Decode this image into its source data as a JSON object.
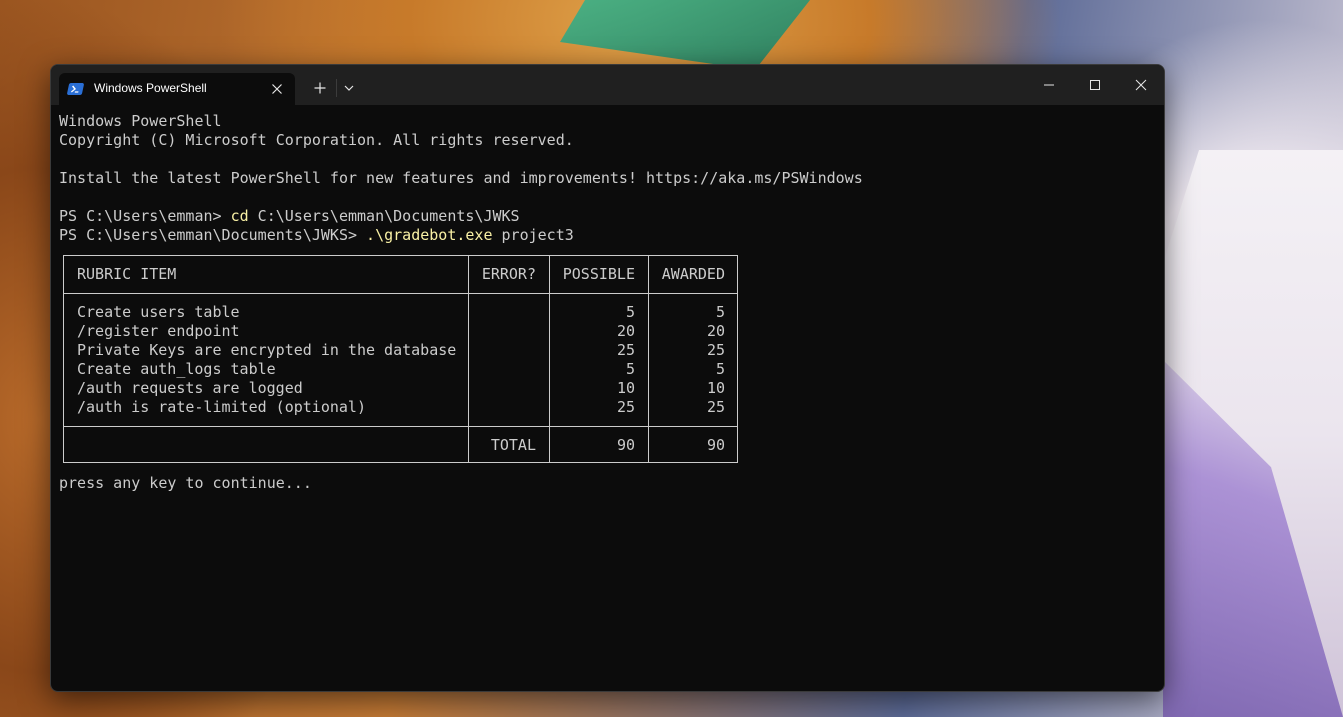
{
  "window": {
    "tab_title": "Windows PowerShell"
  },
  "terminal": {
    "banner_line_1": "Windows PowerShell",
    "banner_line_2": "Copyright (C) Microsoft Corporation. All rights reserved.",
    "install_line": "Install the latest PowerShell for new features and improvements! https://aka.ms/PSWindows",
    "cmd1_prompt": "PS C:\\Users\\emman> ",
    "cmd1_command": "cd",
    "cmd1_args": " C:\\Users\\emman\\Documents\\JWKS",
    "cmd2_prompt": "PS C:\\Users\\emman\\Documents\\JWKS> ",
    "cmd2_command": ".\\gradebot.exe",
    "cmd2_args": " project3",
    "continue_line": "press any key to continue..."
  },
  "rubric": {
    "headers": {
      "item": "RUBRIC ITEM",
      "error": "ERROR?",
      "possible": "POSSIBLE",
      "awarded": "AWARDED"
    },
    "rows": [
      {
        "item": "Create users table",
        "error": "",
        "possible": "5",
        "awarded": "5"
      },
      {
        "item": "/register endpoint",
        "error": "",
        "possible": "20",
        "awarded": "20"
      },
      {
        "item": "Private Keys are encrypted in the database",
        "error": "",
        "possible": "25",
        "awarded": "25"
      },
      {
        "item": "Create auth_logs table",
        "error": "",
        "possible": "5",
        "awarded": "5"
      },
      {
        "item": "/auth requests are logged",
        "error": "",
        "possible": "10",
        "awarded": "10"
      },
      {
        "item": "/auth is rate-limited (optional)",
        "error": "",
        "possible": "25",
        "awarded": "25"
      }
    ],
    "total": {
      "label": "TOTAL",
      "possible": "90",
      "awarded": "90"
    }
  },
  "colors": {
    "terminal_bg": "#0c0c0c",
    "terminal_fg": "#cccccc",
    "command_highlight": "#f9f1a5",
    "titlebar_bg": "#202020",
    "powershell_icon": "#2a6fd6"
  },
  "icons": {
    "tab": "powershell-icon",
    "close_tab": "close-icon",
    "new_tab": "plus-icon",
    "dropdown": "chevron-down-icon",
    "minimize": "minimize-icon",
    "maximize": "maximize-icon",
    "close_window": "close-icon"
  }
}
